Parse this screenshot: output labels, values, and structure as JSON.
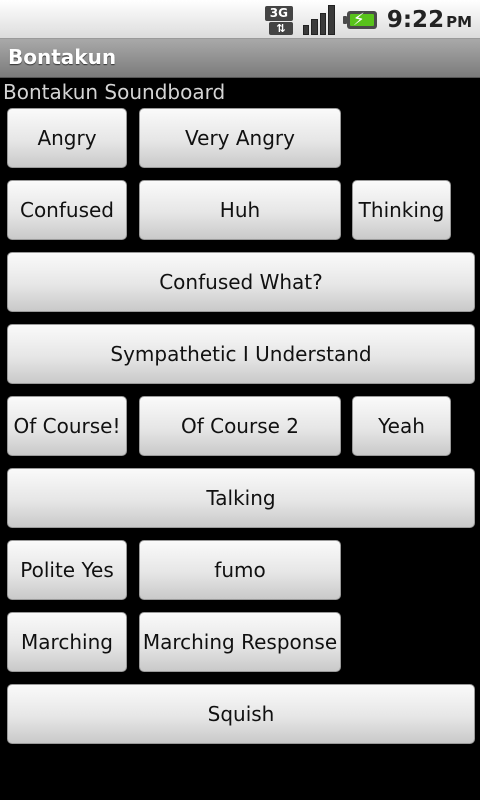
{
  "status": {
    "network": "3G",
    "time": "9:22",
    "ampm": "PM"
  },
  "app": {
    "title": "Bontakun",
    "subtitle": "Bontakun Soundboard"
  },
  "buttons": [
    "Angry",
    "Very Angry",
    "Confused",
    "Huh",
    "Thinking",
    "Confused What?",
    "Sympathetic I Understand",
    "Of Course!",
    "Of Course 2",
    "Yeah",
    "Talking",
    "Polite Yes",
    "fumo",
    "Marching",
    "Marching Response",
    "Squish"
  ],
  "icons": [
    "3g-icon",
    "signal-icon",
    "battery-charging-icon"
  ]
}
